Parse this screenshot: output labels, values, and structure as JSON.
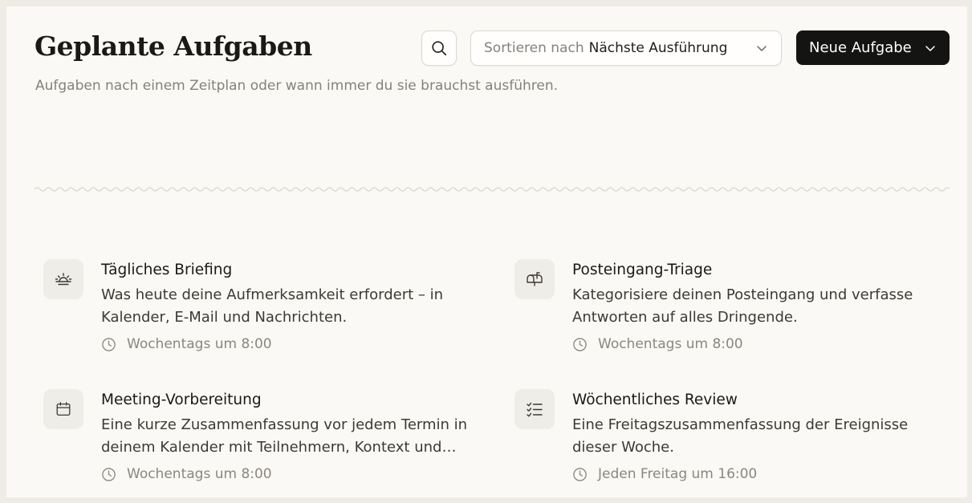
{
  "header": {
    "title": "Geplante Aufgaben",
    "subtitle": "Aufgaben nach einem Zeitplan oder wann immer du sie brauchst ausführen.",
    "search_icon": "search-icon",
    "sort": {
      "prefix": "Sortieren nach",
      "value": "Nächste Ausführung",
      "icon": "chevron-down-icon"
    },
    "new_task_label": "Neue Aufgabe"
  },
  "tasks": [
    {
      "icon": "sunrise-icon",
      "title": "Tägliches Briefing",
      "description": "Was heute deine Aufmerksamkeit erfordert – in Kalender, E-Mail und Nachrichten.",
      "schedule": "Wochentags um 8:00"
    },
    {
      "icon": "mailbox-icon",
      "title": "Posteingang-Triage",
      "description": "Kategorisiere deinen Posteingang und verfasse Antworten auf alles Dringende.",
      "schedule": "Wochentags um 8:00"
    },
    {
      "icon": "calendar-icon",
      "title": "Meeting-Vorbereitung",
      "description": "Eine kurze Zusammenfassung vor jedem Termin in deinem Kalender mit Teilnehmern, Kontext und offenen Punkten.",
      "schedule": "Wochentags um 8:00"
    },
    {
      "icon": "checklist-icon",
      "title": "Wöchentliches Review",
      "description": "Eine Freitagszusammenfassung der Ereignisse dieser Woche.",
      "schedule": "Jeden Freitag um 16:00"
    }
  ],
  "colors": {
    "background": "#faf9f5",
    "primary_button": "#141413",
    "muted_text": "#85817a",
    "icon_box": "#efede7"
  }
}
